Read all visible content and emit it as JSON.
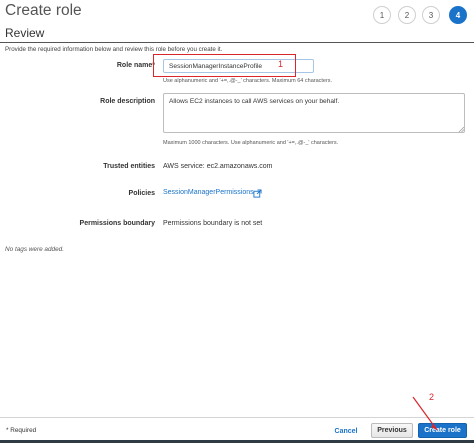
{
  "header": {
    "title": "Create role",
    "steps": [
      "1",
      "2",
      "3",
      "4"
    ],
    "active_step": "4"
  },
  "review": {
    "section_title": "Review",
    "intro": "Provide the required information below and review this role before you create it."
  },
  "fields": {
    "role_name": {
      "label": "Role name*",
      "value": "SessionManagerInstanceProfile",
      "hint": "Use alphanumeric and '+=,.@-_' characters. Maximum 64 characters."
    },
    "role_description": {
      "label": "Role description",
      "value": "Allows EC2 instances to call AWS services on your behalf.",
      "hint": "Maximum 1000 characters. Use alphanumeric and '+=,.@-_' characters."
    },
    "trusted_entities": {
      "label": "Trusted entities",
      "value": "AWS service: ec2.amazonaws.com"
    },
    "policies": {
      "label": "Policies",
      "link": "SessionManagerPermissions"
    },
    "permissions_boundary": {
      "label": "Permissions boundary",
      "value": "Permissions boundary is not set"
    }
  },
  "tags": {
    "empty_text": "No tags were added."
  },
  "footer": {
    "required": "* Required",
    "cancel": "Cancel",
    "previous": "Previous",
    "create": "Create role"
  },
  "annotations": {
    "one": "1",
    "two": "2"
  },
  "colors": {
    "accent": "#1a73c9",
    "annotation": "#d9262c"
  }
}
